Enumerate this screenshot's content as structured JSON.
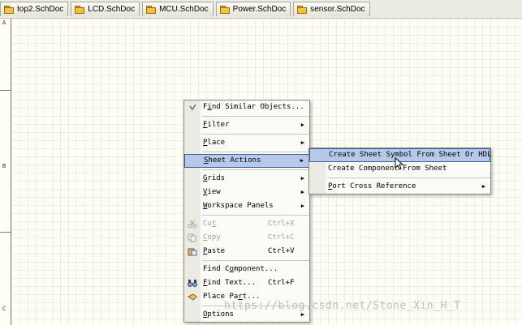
{
  "tabs": [
    {
      "label": "top2.SchDoc",
      "icon": "folder-icon"
    },
    {
      "label": "LCD.SchDoc",
      "icon": "folder-icon"
    },
    {
      "label": "MCU.SchDoc",
      "icon": "folder-icon"
    },
    {
      "label": "Power.SchDoc",
      "icon": "folder-icon"
    },
    {
      "label": "sensor.SchDoc",
      "icon": "folder-icon"
    }
  ],
  "zone_labels": {
    "a": "A",
    "b": "B",
    "c": "C"
  },
  "context_menu": {
    "find_similar": {
      "pre": "F",
      "ul": "i",
      "post": "nd Similar Objects..."
    },
    "filter": {
      "ul": "F",
      "post": "ilter"
    },
    "place": {
      "ul": "P",
      "post": "lace"
    },
    "sheet_actions": {
      "ul": "S",
      "post": "heet Actions"
    },
    "grids": {
      "ul": "G",
      "post": "rids"
    },
    "view": {
      "ul": "V",
      "post": "iew"
    },
    "workspace_panels": {
      "ul": "W",
      "post": "orkspace Panels"
    },
    "cut": {
      "pre": "Cu",
      "ul": "t",
      "shortcut": "Ctrl+X"
    },
    "copy": {
      "ul": "C",
      "post": "opy",
      "shortcut": "Ctrl+C"
    },
    "paste": {
      "ul": "P",
      "post": "aste",
      "shortcut": "Ctrl+V"
    },
    "find_component": {
      "pre": "Find C",
      "ul": "o",
      "post": "mponent..."
    },
    "find_text": {
      "ul": "F",
      "post": "ind Text...",
      "shortcut": "Ctrl+F"
    },
    "place_part": {
      "pre": "Place Pa",
      "ul": "r",
      "post": "t..."
    },
    "options": {
      "ul": "O",
      "post": "ptions"
    }
  },
  "submenu": {
    "create_symbol": "Create Sheet Symbol From Sheet Or HDL",
    "create_component": "Create Component From Sheet",
    "port_cross": {
      "ul": "P",
      "post": "ort Cross Reference"
    }
  },
  "watermark": "https://blog.csdn.net/Stone_Xin_H_T",
  "colors": {
    "highlight": "#b6c9e8",
    "highlight_border": "#3a5f9e",
    "gutter": "#ecebe3"
  }
}
